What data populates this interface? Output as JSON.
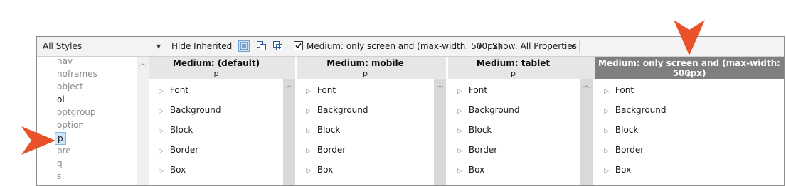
{
  "toolbar": {
    "styles_combo": "All Styles",
    "hide_inherited": "Hide Inherited",
    "medium_checked": true,
    "medium_label": "Medium: only screen and (max-width: 500px)",
    "show_label": "Show: All Properties"
  },
  "selectors": [
    {
      "label": "nav",
      "state": "normal"
    },
    {
      "label": "noframes",
      "state": "normal"
    },
    {
      "label": "object",
      "state": "normal"
    },
    {
      "label": "ol",
      "state": "dark"
    },
    {
      "label": "optgroup",
      "state": "normal"
    },
    {
      "label": "option",
      "state": "normal"
    },
    {
      "label": "p",
      "state": "selected"
    },
    {
      "label": "pre",
      "state": "normal"
    },
    {
      "label": "q",
      "state": "normal"
    },
    {
      "label": "s",
      "state": "normal"
    }
  ],
  "panels": [
    {
      "title": "Medium: (default)",
      "selector": "p",
      "close": "x",
      "active": false
    },
    {
      "title": "Medium: mobile",
      "selector": "p",
      "close": "x",
      "active": false
    },
    {
      "title": "Medium: tablet",
      "selector": "p",
      "close": "x",
      "active": false
    },
    {
      "title": "Medium: only screen and (max-width: 500px)",
      "selector": "p",
      "close": "",
      "active": true
    }
  ],
  "property_groups": [
    "Font",
    "Background",
    "Block",
    "Border",
    "Box"
  ],
  "colors": {
    "callout": "#e8512a",
    "active_header": "#7f7f7f",
    "header": "#e6e6e6",
    "selection": "#cde8fb"
  }
}
